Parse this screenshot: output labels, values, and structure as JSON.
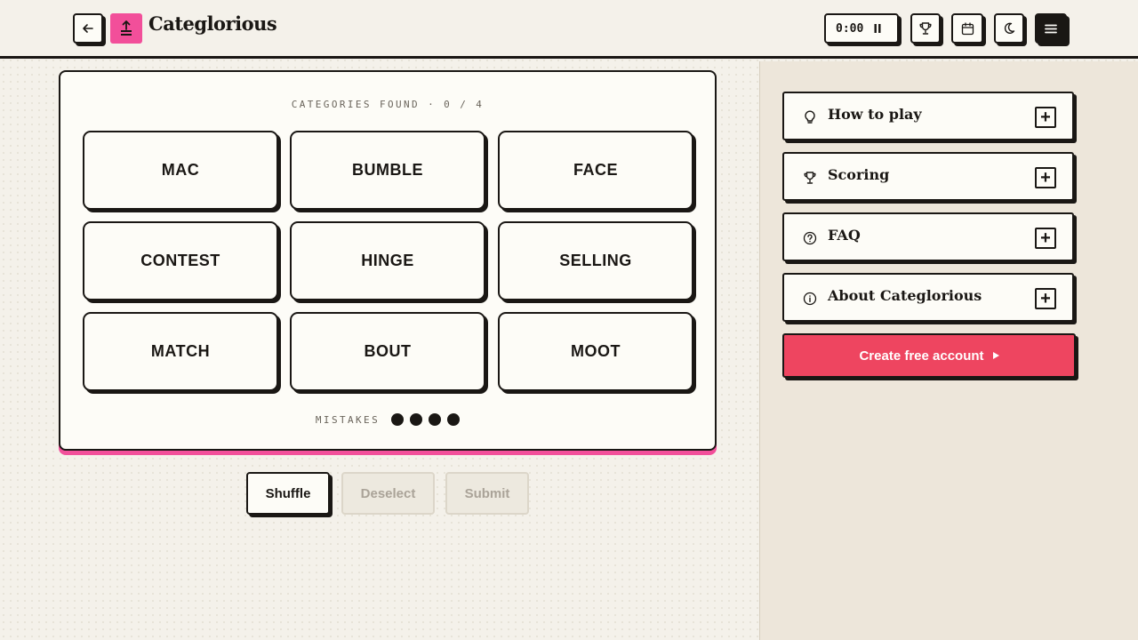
{
  "header": {
    "brand": "Categlorious",
    "timer": "0:00"
  },
  "game": {
    "found_label": "CATEGORIES FOUND · 0 / 4",
    "tiles": [
      "MAC",
      "BUMBLE",
      "FACE",
      "CONTEST",
      "HINGE",
      "SELLING",
      "MATCH",
      "BOUT",
      "MOOT"
    ],
    "mistakes_label": "MISTAKES",
    "mistakes_remaining": 4
  },
  "actions": {
    "shuffle": "Shuffle",
    "deselect": "Deselect",
    "submit": "Submit"
  },
  "sidebar": {
    "accordion": [
      {
        "label": "How to play",
        "icon": "lightbulb-icon"
      },
      {
        "label": "Scoring",
        "icon": "trophy-icon"
      },
      {
        "label": "FAQ",
        "icon": "question-circle-icon"
      },
      {
        "label": "About Categlorious",
        "icon": "info-circle-icon"
      }
    ],
    "cta": "Create free account"
  },
  "colors": {
    "accent_pink": "#f24f9a",
    "cta_red": "#ee4560",
    "ink": "#1a1714",
    "paper": "#fdfcf7"
  }
}
